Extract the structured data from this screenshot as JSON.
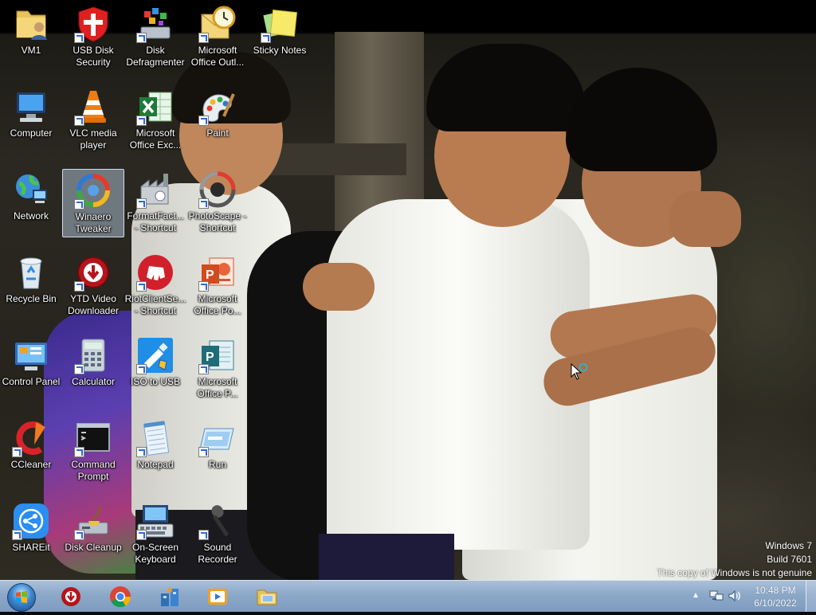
{
  "desktop": {
    "icons": [
      {
        "label": "VM1",
        "icon": "folder-user-icon",
        "shortcut": false
      },
      {
        "label": "Computer",
        "icon": "computer-icon",
        "shortcut": false
      },
      {
        "label": "Network",
        "icon": "network-icon",
        "shortcut": false
      },
      {
        "label": "Recycle Bin",
        "icon": "recycle-bin-icon",
        "shortcut": false
      },
      {
        "label": "Control Panel",
        "icon": "control-panel-icon",
        "shortcut": false
      },
      {
        "label": "CCleaner",
        "icon": "ccleaner-icon",
        "shortcut": true
      },
      {
        "label": "SHAREit",
        "icon": "shareit-icon",
        "shortcut": true
      },
      {
        "label": "USB Disk Security",
        "icon": "usb-disk-security-icon",
        "shortcut": true
      },
      {
        "label": "VLC media player",
        "icon": "vlc-icon",
        "shortcut": true
      },
      {
        "label": "Winaero Tweaker",
        "icon": "winaero-tweaker-icon",
        "shortcut": true,
        "selected": true
      },
      {
        "label": "YTD Video Downloader",
        "icon": "ytd-downloader-icon",
        "shortcut": true
      },
      {
        "label": "Calculator",
        "icon": "calculator-icon",
        "shortcut": true
      },
      {
        "label": "Command Prompt",
        "icon": "command-prompt-icon",
        "shortcut": true
      },
      {
        "label": "Disk Cleanup",
        "icon": "disk-cleanup-icon",
        "shortcut": true
      },
      {
        "label": "Disk Defragmenter",
        "icon": "disk-defragmenter-icon",
        "shortcut": true
      },
      {
        "label": "Microsoft Office Exc...",
        "icon": "excel-icon",
        "shortcut": true
      },
      {
        "label": "FormatFact... - Shortcut",
        "icon": "format-factory-icon",
        "shortcut": true
      },
      {
        "label": "RiotClientSe... - Shortcut",
        "icon": "riot-client-icon",
        "shortcut": true
      },
      {
        "label": "ISO to USB",
        "icon": "iso-to-usb-icon",
        "shortcut": true
      },
      {
        "label": "Notepad",
        "icon": "notepad-icon",
        "shortcut": true
      },
      {
        "label": "On-Screen Keyboard",
        "icon": "on-screen-keyboard-icon",
        "shortcut": true
      },
      {
        "label": "Microsoft Office Outl...",
        "icon": "outlook-icon",
        "shortcut": true
      },
      {
        "label": "Paint",
        "icon": "paint-icon",
        "shortcut": true
      },
      {
        "label": "PhotoScape - Shortcut",
        "icon": "photoscape-icon",
        "shortcut": true
      },
      {
        "label": "Microsoft Office Po...",
        "icon": "powerpoint-icon",
        "shortcut": true
      },
      {
        "label": "Microsoft Office P...",
        "icon": "publisher-icon",
        "shortcut": true
      },
      {
        "label": "Run",
        "icon": "run-icon",
        "shortcut": true
      },
      {
        "label": "Sound Recorder",
        "icon": "sound-recorder-icon",
        "shortcut": true
      },
      {
        "label": "Sticky Notes",
        "icon": "sticky-notes-icon",
        "shortcut": true
      }
    ]
  },
  "watermark": {
    "line1": "Windows 7",
    "line2": "Build 7601",
    "line3": "This copy of Windows is not genuine"
  },
  "taskbar": {
    "pinned": [
      {
        "icon": "ytd-taskbar-icon"
      },
      {
        "icon": "chrome-icon"
      },
      {
        "icon": "network-app-icon"
      },
      {
        "icon": "media-player-icon"
      },
      {
        "icon": "explorer-folder-icon"
      }
    ],
    "tray": {
      "arrow": "▲",
      "time": "10:48 PM",
      "date": "6/10/2022"
    }
  },
  "colors": {
    "taskbar": "#8ca8c8",
    "selection": "#c8dcf5",
    "shortcut_arrow": "#2f6ad8"
  }
}
